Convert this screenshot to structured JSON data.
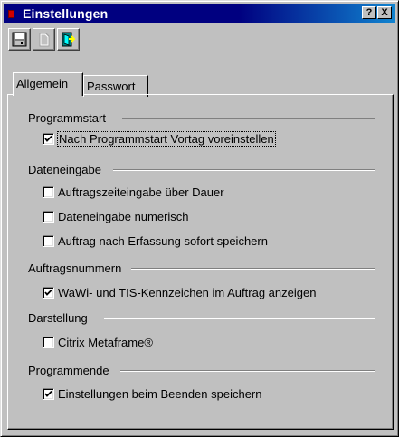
{
  "window": {
    "title": "Einstellungen"
  },
  "titlebar_buttons": {
    "help": "?",
    "close": "X"
  },
  "toolbar": [
    {
      "name": "save-icon",
      "enabled": true
    },
    {
      "name": "new-icon",
      "enabled": false
    },
    {
      "name": "exit-icon",
      "enabled": true
    }
  ],
  "tabs": [
    {
      "label": "Allgemein",
      "active": true
    },
    {
      "label": "Passwort",
      "active": false
    }
  ],
  "groups": {
    "programmstart": {
      "title": "Programmstart",
      "items": [
        {
          "label": "Nach Programmstart Vortag voreinstellen",
          "checked": true
        }
      ]
    },
    "dateneingabe": {
      "title": "Dateneingabe",
      "items": [
        {
          "label": "Auftragszeiteingabe über Dauer",
          "checked": false
        },
        {
          "label": "Dateneingabe numerisch",
          "checked": false
        },
        {
          "label": "Auftrag nach Erfassung sofort speichern",
          "checked": false
        }
      ]
    },
    "auftragsnummern": {
      "title": "Auftragsnummern",
      "items": [
        {
          "label": "WaWi- und TIS-Kennzeichen im Auftrag anzeigen",
          "checked": true
        }
      ]
    },
    "darstellung": {
      "title": "Darstellung",
      "items": [
        {
          "label": "Citrix Metaframe®",
          "checked": false
        }
      ]
    },
    "programmende": {
      "title": "Programmende",
      "items": [
        {
          "label": "Einstellungen beim Beenden speichern",
          "checked": true
        }
      ]
    }
  }
}
